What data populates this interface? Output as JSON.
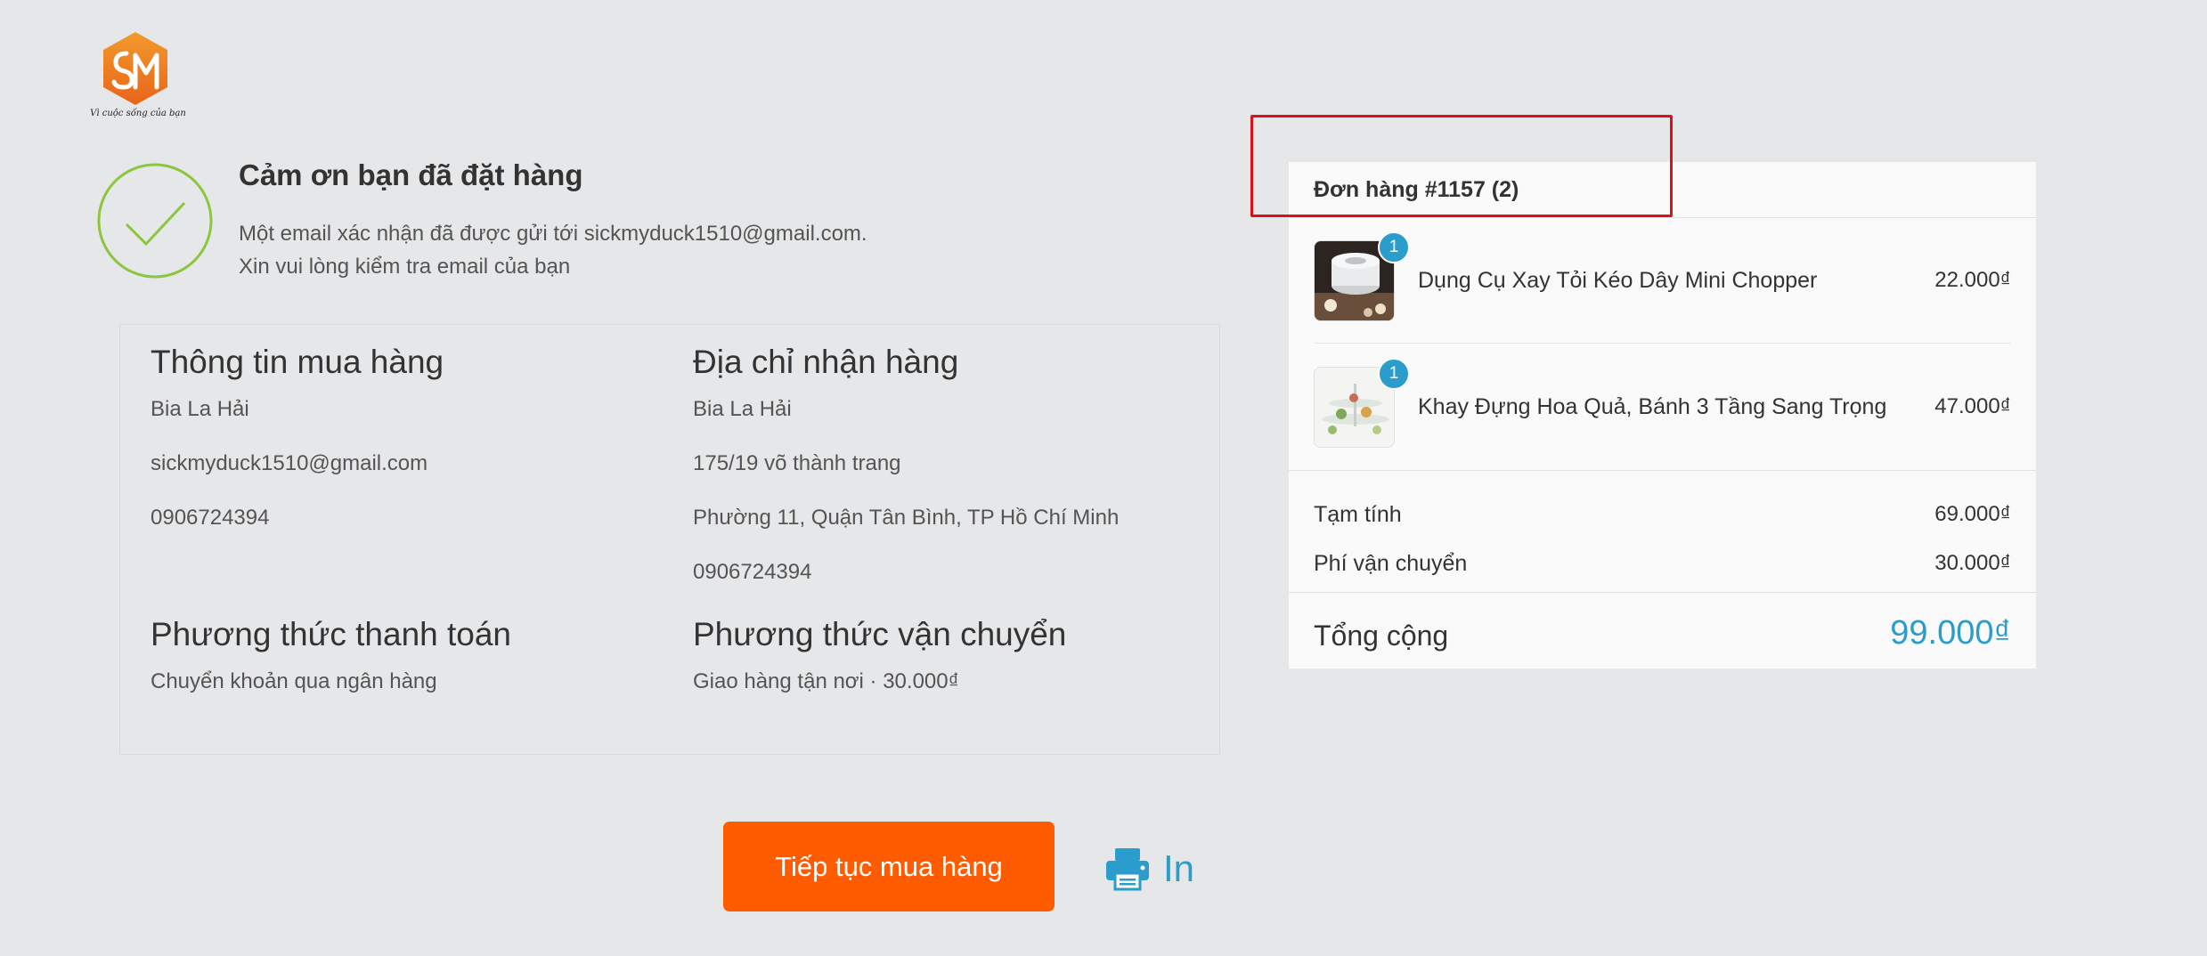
{
  "brand": {
    "logo_letters": "SM",
    "tagline": "Vì cuộc sống của bạn"
  },
  "thanks": {
    "title": "Cảm ơn bạn đã đặt hàng",
    "line1": "Một email xác nhận đã được gửi tới sickmyduck1510@gmail.com.",
    "line2": "Xin vui lòng kiểm tra email của bạn"
  },
  "purchase_info": {
    "title": "Thông tin mua hàng",
    "name": "Bia La Hải",
    "email": "sickmyduck1510@gmail.com",
    "phone": "0906724394"
  },
  "shipping_address": {
    "title": "Địa chỉ nhận hàng",
    "name": "Bia La Hải",
    "street": "175/19 võ thành trang",
    "district": "Phường 11, Quận Tân Bình, TP Hồ Chí Minh",
    "phone": "0906724394"
  },
  "payment_method": {
    "title": "Phương thức thanh toán",
    "value": "Chuyển khoản qua ngân hàng"
  },
  "shipping_method": {
    "title": "Phương thức vận chuyển",
    "value": "Giao hàng tận nơi · 30.000₫"
  },
  "order": {
    "header": "Đơn hàng #1157 (2)",
    "items": [
      {
        "name": "Dụng Cụ Xay Tỏi Kéo Dây Mini Chopper",
        "qty": "1",
        "price": "22.000₫"
      },
      {
        "name": "Khay Đựng Hoa Quả, Bánh 3 Tầng Sang Trọng",
        "qty": "1",
        "price": "47.000₫"
      }
    ],
    "subtotal_label": "Tạm tính",
    "subtotal": "69.000₫",
    "shipping_label": "Phí vận chuyển",
    "shipping": "30.000₫",
    "total_label": "Tổng cộng",
    "total": "99.000₫"
  },
  "actions": {
    "continue_label": "Tiếp tục mua hàng",
    "print_label": "In"
  },
  "colors": {
    "accent": "#2a9dcc",
    "button": "#ff5b00",
    "check": "#8cc63f",
    "highlight": "#e0101a"
  }
}
